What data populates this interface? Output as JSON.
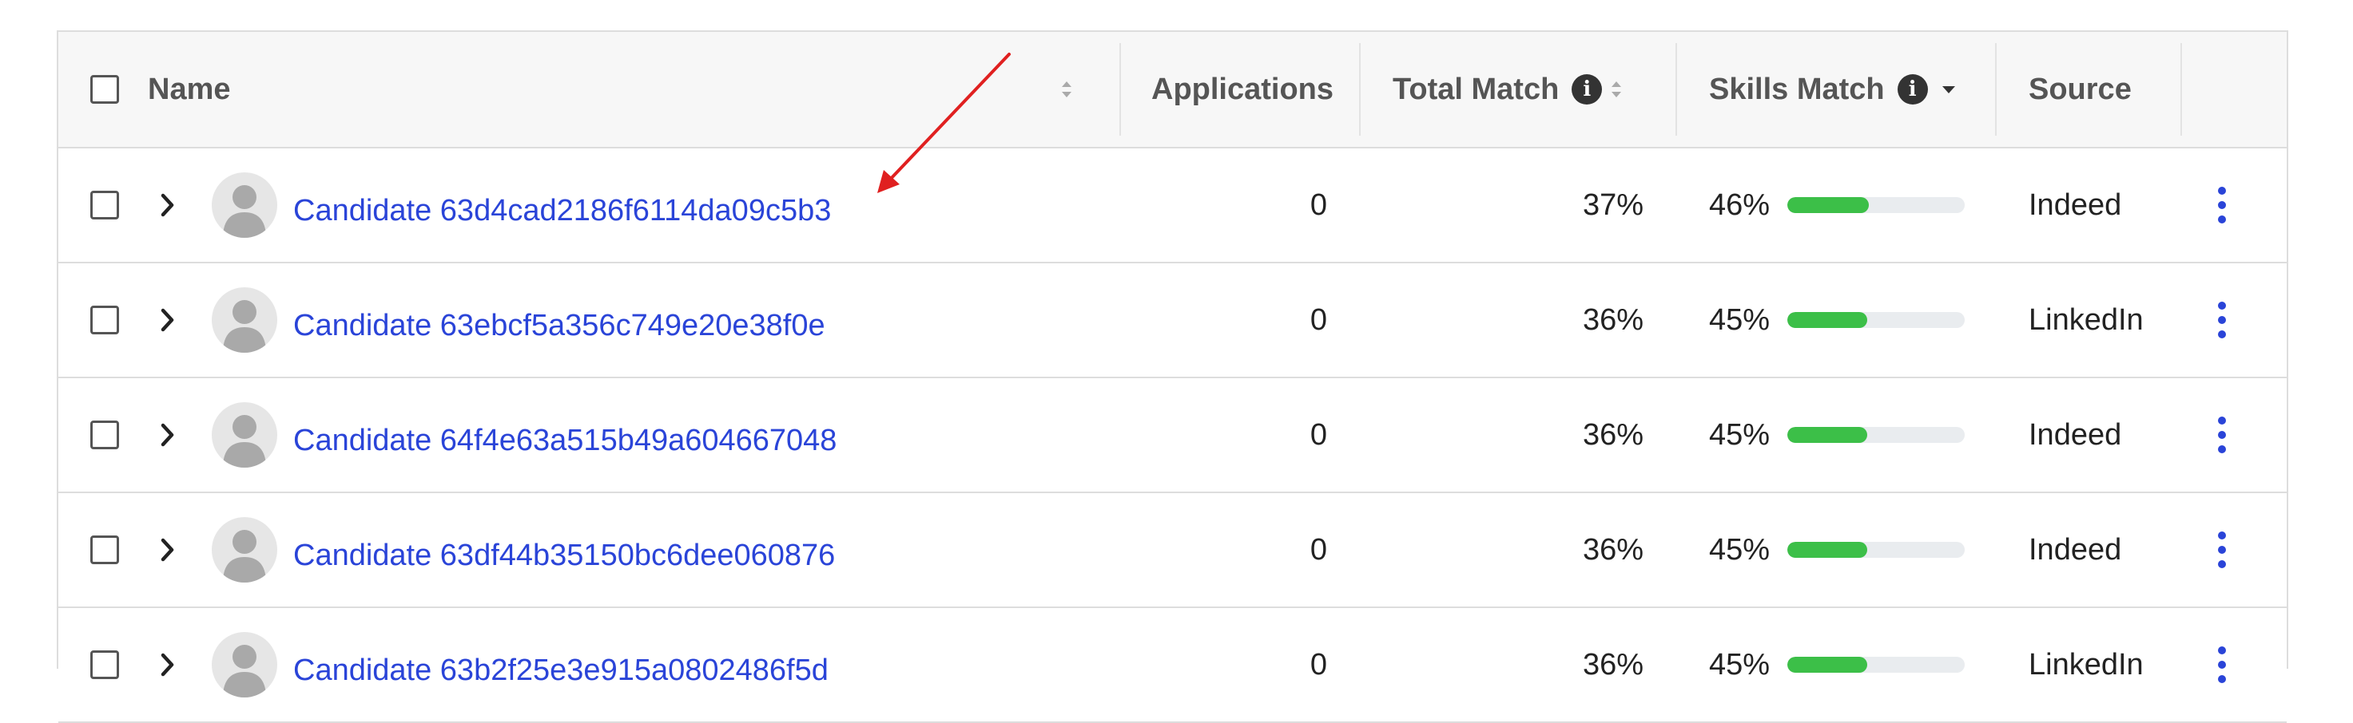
{
  "header": {
    "name_label": "Name",
    "applications_label": "Applications",
    "total_match_label": "Total Match",
    "skills_match_label": "Skills Match",
    "source_label": "Source",
    "info_glyph": "i"
  },
  "colors": {
    "link": "#2a44d8",
    "bar_fill": "#3cbf48",
    "bar_track": "#e9ecef",
    "annotation_arrow": "#e02020",
    "kebab": "#2a44d8"
  },
  "rows": [
    {
      "name": "Candidate 63d4cad2186f6114da09c5b3",
      "applications": "0",
      "total_match": "37%",
      "skills_match": "46%",
      "skills_fraction": 0.46,
      "source": "Indeed"
    },
    {
      "name": "Candidate 63ebcf5a356c749e20e38f0e",
      "applications": "0",
      "total_match": "36%",
      "skills_match": "45%",
      "skills_fraction": 0.45,
      "source": "LinkedIn"
    },
    {
      "name": "Candidate 64f4e63a515b49a604667048",
      "applications": "0",
      "total_match": "36%",
      "skills_match": "45%",
      "skills_fraction": 0.45,
      "source": "Indeed"
    },
    {
      "name": "Candidate 63df44b35150bc6dee060876",
      "applications": "0",
      "total_match": "36%",
      "skills_match": "45%",
      "skills_fraction": 0.45,
      "source": "Indeed"
    },
    {
      "name": "Candidate 63b2f25e3e915a0802486f5d",
      "applications": "0",
      "total_match": "36%",
      "skills_match": "45%",
      "skills_fraction": 0.45,
      "source": "LinkedIn"
    }
  ]
}
